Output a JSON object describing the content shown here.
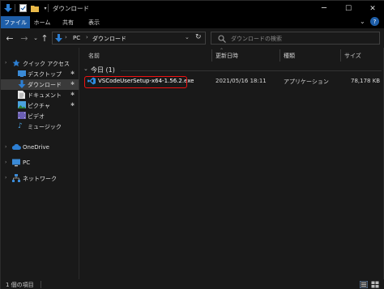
{
  "window": {
    "title": "ダウンロード",
    "minimize": "─",
    "maximize": "☐",
    "close": "✕"
  },
  "ribbon": {
    "tabs": [
      {
        "label": "ファイル",
        "active": true
      },
      {
        "label": "ホーム"
      },
      {
        "label": "共有"
      },
      {
        "label": "表示"
      }
    ]
  },
  "address": {
    "segments": [
      "PC",
      "ダウンロード"
    ],
    "separator": "›",
    "search_placeholder": "ダウンロードの検索"
  },
  "sidebar": {
    "items": [
      {
        "label": "クイック アクセス",
        "icon": "star-icon"
      },
      {
        "label": "デスクトップ",
        "icon": "desktop-folder-icon",
        "pinned": true
      },
      {
        "label": "ダウンロード",
        "icon": "download-folder-icon",
        "pinned": true,
        "selected": true
      },
      {
        "label": "ドキュメント",
        "icon": "documents-folder-icon",
        "pinned": true
      },
      {
        "label": "ピクチャ",
        "icon": "pictures-folder-icon",
        "pinned": true
      },
      {
        "label": "ビデオ",
        "icon": "videos-folder-icon"
      },
      {
        "label": "ミュージック",
        "icon": "music-folder-icon"
      },
      {
        "label": "OneDrive",
        "icon": "onedrive-cloud-icon"
      },
      {
        "label": "PC",
        "icon": "pc-icon"
      },
      {
        "label": "ネットワーク",
        "icon": "network-icon"
      }
    ]
  },
  "columns": [
    "名前",
    "更新日時",
    "種類",
    "サイズ"
  ],
  "group": {
    "label": "今日 (1)"
  },
  "files": [
    {
      "name": "VSCodeUserSetup-x64-1.56.2.exe",
      "modified": "2021/05/16 18:11",
      "type": "アプリケーション",
      "size": "78,178 KB"
    }
  ],
  "status": {
    "text": "1 個の項目"
  },
  "colors": {
    "accent": "#1e5ea8",
    "highlight": "#ee1111",
    "folder_yellow": "#e9b949",
    "download_blue": "#2d7fd3"
  }
}
